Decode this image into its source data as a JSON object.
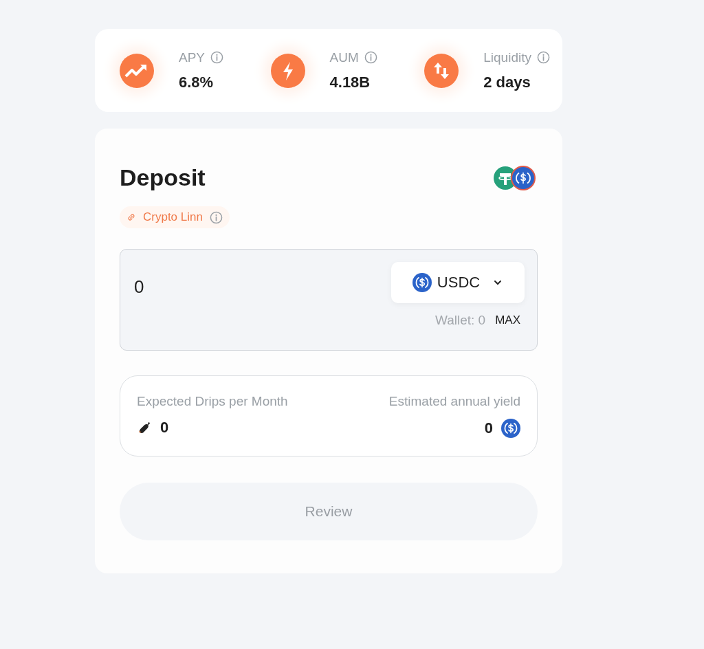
{
  "stats": [
    {
      "kind": "trend",
      "label": "APY",
      "value": "6.8%"
    },
    {
      "kind": "bolt",
      "label": "AUM",
      "value": "4.18B"
    },
    {
      "kind": "swap",
      "label": "Liquidity",
      "value": "2 days"
    }
  ],
  "deposit": {
    "title": "Deposit",
    "source": "Crypto Linn",
    "amount": "0",
    "token": "USDC",
    "wallet": "Wallet: 0",
    "max": "MAX"
  },
  "summary": {
    "drips_label": "Expected Drips per Month",
    "drips_value": "0",
    "yield_label": "Estimated annual yield",
    "yield_value": "0"
  },
  "review": {
    "label": "Review",
    "disabled": true
  }
}
